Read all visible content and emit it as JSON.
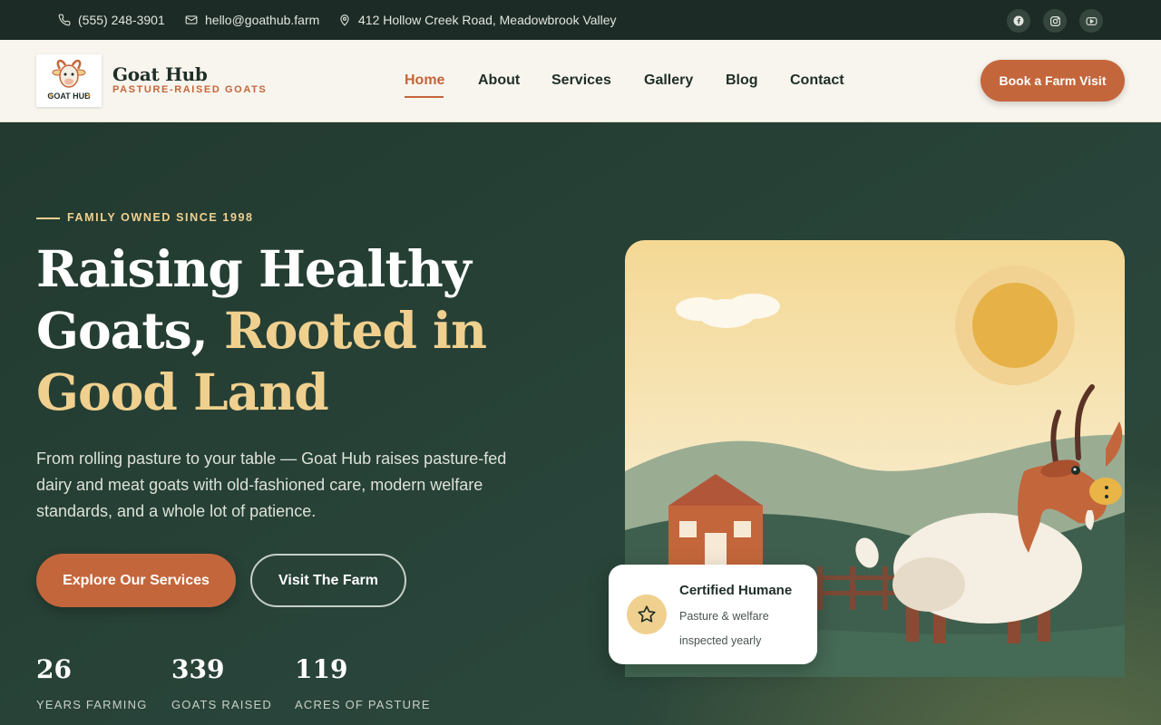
{
  "topbar": {
    "phone": "(555) 248-3901",
    "email": "hello@goathub.farm",
    "address": "412 Hollow Creek Road, Meadowbrook Valley",
    "social": [
      "facebook-icon",
      "instagram-icon",
      "youtube-icon"
    ]
  },
  "brand": {
    "name": "Goat Hub",
    "tagline": "PASTURE-RAISED GOATS",
    "logo_text": "GOAT HUB",
    "accent": "#c4663b",
    "gold": "#f0d08e"
  },
  "nav": {
    "items": [
      "Home",
      "About",
      "Services",
      "Gallery",
      "Blog",
      "Contact"
    ],
    "active": "Home",
    "cta": "Book a Farm Visit"
  },
  "hero": {
    "eyebrow": "FAMILY OWNED SINCE 1998",
    "headline_line1": "Raising Healthy",
    "headline_line2a": "Goats,",
    "headline_line2b": "Rooted in",
    "headline_line3": "Good Land",
    "lead": "From rolling pasture to your table — Goat Hub raises pasture-fed dairy and meat goats with old-fashioned care, modern welfare standards, and a whole lot of patience.",
    "primary_button": "Explore Our Services",
    "secondary_button": "Visit The Farm",
    "stats": [
      {
        "value": "26",
        "label": "YEARS FARMING"
      },
      {
        "value": "339",
        "label": "GOATS RAISED"
      },
      {
        "value": "119",
        "label": "ACRES OF PASTURE"
      }
    ]
  },
  "badge": {
    "title": "Certified Humane",
    "subtitle": "Pasture & welfare inspected yearly",
    "icon": "star-icon"
  }
}
